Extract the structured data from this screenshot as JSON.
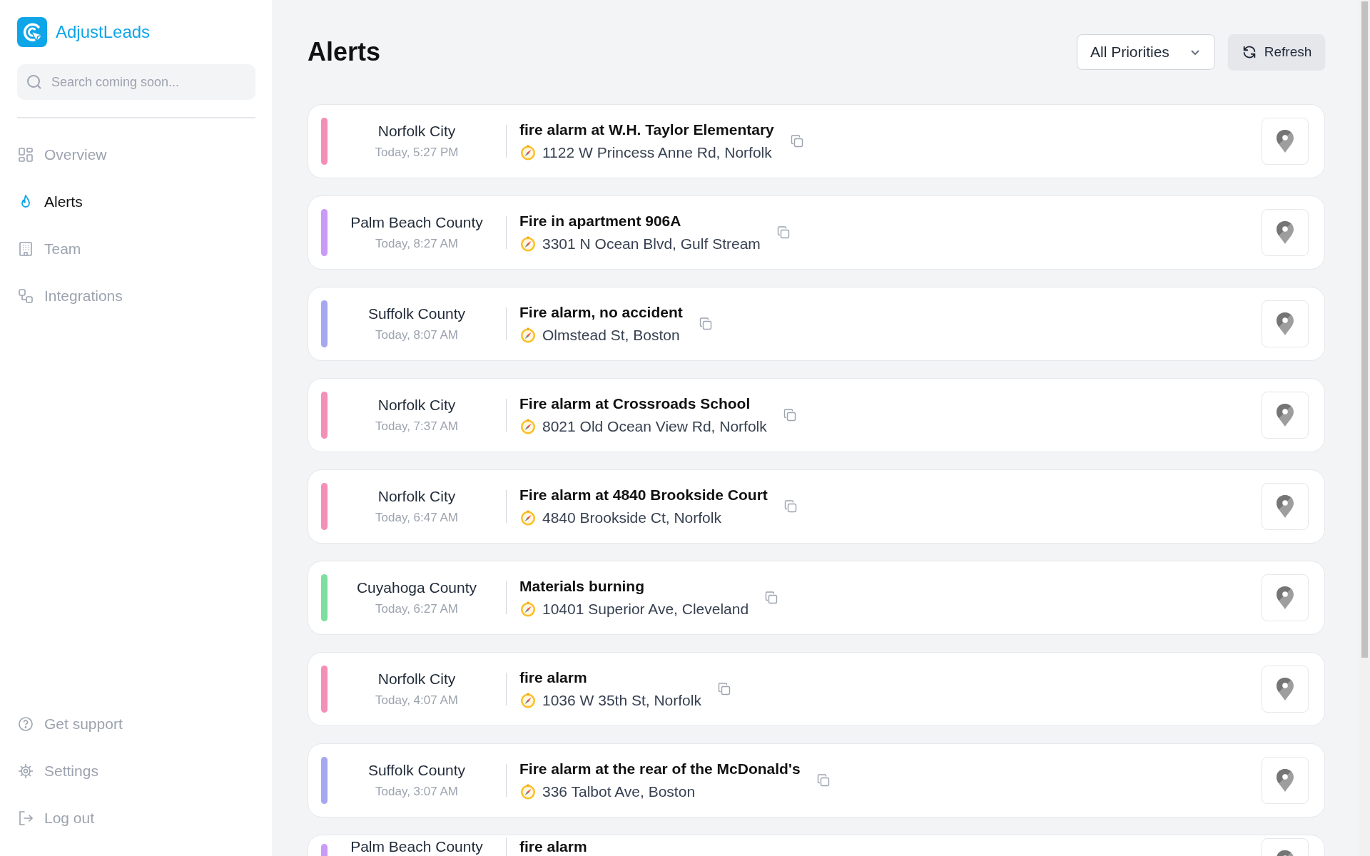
{
  "brand": {
    "name": "AdjustLeads"
  },
  "search": {
    "placeholder": "Search coming soon..."
  },
  "nav": [
    {
      "kind": "overview",
      "label": "Overview",
      "selected": false
    },
    {
      "kind": "alerts",
      "label": "Alerts",
      "selected": true
    },
    {
      "kind": "team",
      "label": "Team",
      "selected": false
    },
    {
      "kind": "integrations",
      "label": "Integrations",
      "selected": false
    }
  ],
  "footer_nav": [
    {
      "kind": "support",
      "label": "Get support"
    },
    {
      "kind": "settings",
      "label": "Settings"
    },
    {
      "kind": "logout",
      "label": "Log out"
    }
  ],
  "page": {
    "title": "Alerts",
    "filter": "All Priorities",
    "refresh": "Refresh"
  },
  "alerts": [
    {
      "region": "Norfolk City",
      "time": "Today, 5:27 PM",
      "title": "fire alarm at W.H. Taylor Elementary",
      "address": "1122 W Princess Anne Rd, Norfolk",
      "color": "#f48fb8"
    },
    {
      "region": "Palm Beach County",
      "time": "Today, 8:27 AM",
      "title": "Fire in apartment 906A",
      "address": "3301 N Ocean Blvd, Gulf Stream",
      "color": "#c99af7"
    },
    {
      "region": "Suffolk County",
      "time": "Today, 8:07 AM",
      "title": "Fire alarm, no accident",
      "address": "Olmstead St, Boston",
      "color": "#a5a8f0"
    },
    {
      "region": "Norfolk City",
      "time": "Today, 7:37 AM",
      "title": "Fire alarm at Crossroads School",
      "address": "8021 Old Ocean View Rd, Norfolk",
      "color": "#f48fb8"
    },
    {
      "region": "Norfolk City",
      "time": "Today, 6:47 AM",
      "title": "Fire alarm at 4840 Brookside Court",
      "address": "4840 Brookside Ct, Norfolk",
      "color": "#f48fb8"
    },
    {
      "region": "Cuyahoga County",
      "time": "Today, 6:27 AM",
      "title": "Materials burning",
      "address": "10401 Superior Ave, Cleveland",
      "color": "#7ddf9f"
    },
    {
      "region": "Norfolk City",
      "time": "Today, 4:07 AM",
      "title": "fire alarm",
      "address": "1036 W 35th St, Norfolk",
      "color": "#f48fb8"
    },
    {
      "region": "Suffolk County",
      "time": "Today, 3:07 AM",
      "title": "Fire alarm at the rear of the McDonald's",
      "address": "336 Talbot Ave, Boston",
      "color": "#a5a8f0"
    },
    {
      "region": "Palm Beach County",
      "title": "fire alarm",
      "color": "#c99af7"
    }
  ]
}
